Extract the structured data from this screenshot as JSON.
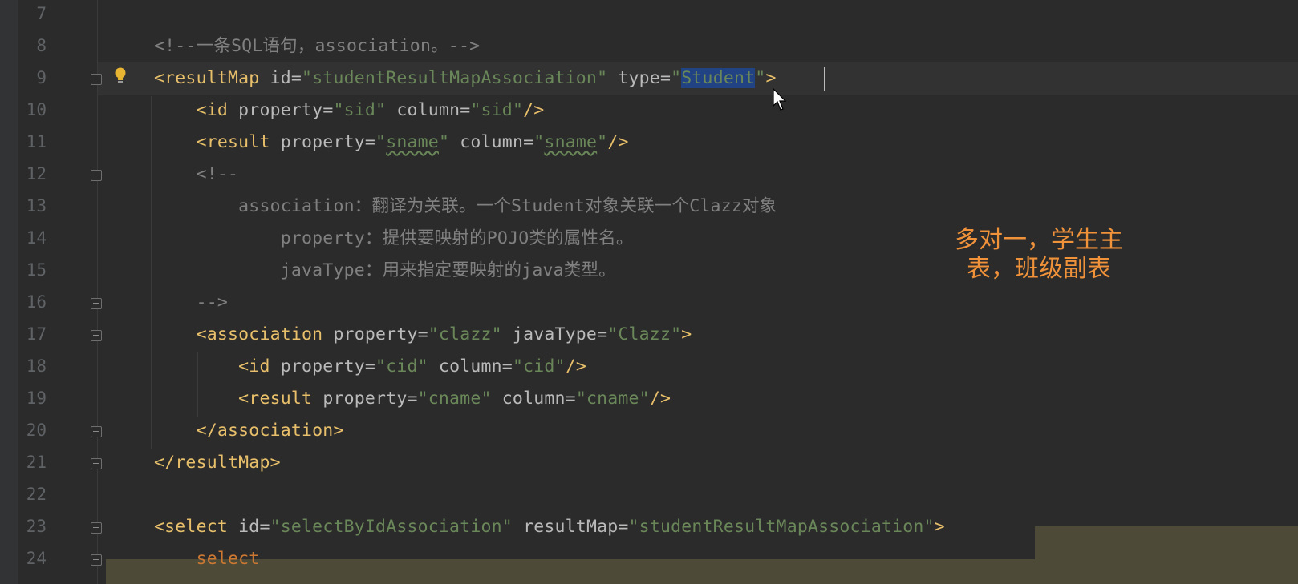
{
  "editor": {
    "lines": [
      {
        "num": "7",
        "tokens": []
      },
      {
        "num": "8",
        "tokens": [
          {
            "t": "cmt",
            "v": "<!--一条SQL语句，association。-->"
          }
        ]
      },
      {
        "num": "9",
        "tokens": [
          {
            "t": "tag",
            "v": "<resultMap "
          },
          {
            "t": "attr",
            "v": "id"
          },
          {
            "t": "eq",
            "v": "="
          },
          {
            "t": "val",
            "v": "\"studentResultMapAssociation\" "
          },
          {
            "t": "attr",
            "v": "type"
          },
          {
            "t": "eq",
            "v": "="
          },
          {
            "t": "val",
            "v": "\""
          },
          {
            "t": "sel",
            "v": "Student"
          },
          {
            "t": "val",
            "v": "\""
          },
          {
            "t": "tag",
            "v": ">"
          }
        ]
      },
      {
        "num": "10",
        "tokens": [
          {
            "t": "tag",
            "v": "    <id "
          },
          {
            "t": "attr",
            "v": "property"
          },
          {
            "t": "eq",
            "v": "="
          },
          {
            "t": "val",
            "v": "\"sid\" "
          },
          {
            "t": "attr",
            "v": "column"
          },
          {
            "t": "eq",
            "v": "="
          },
          {
            "t": "val",
            "v": "\"sid\""
          },
          {
            "t": "tag",
            "v": "/>"
          }
        ]
      },
      {
        "num": "11",
        "tokens": [
          {
            "t": "tag",
            "v": "    <result "
          },
          {
            "t": "attr",
            "v": "property"
          },
          {
            "t": "eq",
            "v": "="
          },
          {
            "t": "val",
            "v": "\""
          },
          {
            "t": "sq",
            "v": "sname"
          },
          {
            "t": "val",
            "v": "\" "
          },
          {
            "t": "attr",
            "v": "column"
          },
          {
            "t": "eq",
            "v": "="
          },
          {
            "t": "val",
            "v": "\""
          },
          {
            "t": "sq",
            "v": "sname"
          },
          {
            "t": "val",
            "v": "\""
          },
          {
            "t": "tag",
            "v": "/>"
          }
        ]
      },
      {
        "num": "12",
        "tokens": [
          {
            "t": "cmt",
            "v": "    <!--"
          }
        ]
      },
      {
        "num": "13",
        "tokens": [
          {
            "t": "cmt",
            "v": "        association：翻译为关联。一个Student对象关联一个Clazz对象"
          }
        ]
      },
      {
        "num": "14",
        "tokens": [
          {
            "t": "cmt",
            "v": "            property：提供要映射的POJO类的属性名。"
          }
        ]
      },
      {
        "num": "15",
        "tokens": [
          {
            "t": "cmt",
            "v": "            javaType：用来指定要映射的java类型。"
          }
        ]
      },
      {
        "num": "16",
        "tokens": [
          {
            "t": "cmt",
            "v": "    -->"
          }
        ]
      },
      {
        "num": "17",
        "tokens": [
          {
            "t": "tag",
            "v": "    <association "
          },
          {
            "t": "attr",
            "v": "property"
          },
          {
            "t": "eq",
            "v": "="
          },
          {
            "t": "val",
            "v": "\"clazz\" "
          },
          {
            "t": "attr",
            "v": "javaType"
          },
          {
            "t": "eq",
            "v": "="
          },
          {
            "t": "val",
            "v": "\"Clazz\""
          },
          {
            "t": "tag",
            "v": ">"
          }
        ]
      },
      {
        "num": "18",
        "tokens": [
          {
            "t": "tag",
            "v": "        <id "
          },
          {
            "t": "attr",
            "v": "property"
          },
          {
            "t": "eq",
            "v": "="
          },
          {
            "t": "val",
            "v": "\"cid\" "
          },
          {
            "t": "attr",
            "v": "column"
          },
          {
            "t": "eq",
            "v": "="
          },
          {
            "t": "val",
            "v": "\"cid\""
          },
          {
            "t": "tag",
            "v": "/>"
          }
        ]
      },
      {
        "num": "19",
        "tokens": [
          {
            "t": "tag",
            "v": "        <result "
          },
          {
            "t": "attr",
            "v": "property"
          },
          {
            "t": "eq",
            "v": "="
          },
          {
            "t": "val",
            "v": "\"cname\" "
          },
          {
            "t": "attr",
            "v": "column"
          },
          {
            "t": "eq",
            "v": "="
          },
          {
            "t": "val",
            "v": "\"cname\""
          },
          {
            "t": "tag",
            "v": "/>"
          }
        ]
      },
      {
        "num": "20",
        "tokens": [
          {
            "t": "tag",
            "v": "    </association>"
          }
        ]
      },
      {
        "num": "21",
        "tokens": [
          {
            "t": "tag",
            "v": "</resultMap>"
          }
        ]
      },
      {
        "num": "22",
        "tokens": []
      },
      {
        "num": "23",
        "tokens": [
          {
            "t": "tag",
            "v": "<select "
          },
          {
            "t": "attr",
            "v": "id"
          },
          {
            "t": "eq",
            "v": "="
          },
          {
            "t": "val",
            "v": "\"selectByIdAssociation\" "
          },
          {
            "t": "attr",
            "v": "resultMap"
          },
          {
            "t": "eq",
            "v": "="
          },
          {
            "t": "val",
            "v": "\"studentResultMapAssociation\""
          },
          {
            "t": "tag",
            "v": ">"
          }
        ]
      },
      {
        "num": "24",
        "tokens": [
          {
            "t": "kw",
            "v": "    select"
          }
        ]
      }
    ]
  },
  "annotation": {
    "line1": "多对一，学生主",
    "line2": "表，班级副表"
  },
  "colors": {
    "background": "#2b2b2b",
    "tag": "#e8bf6a",
    "string": "#6a8759",
    "comment": "#808080",
    "selection": "#214283",
    "annotation": "#f0923a",
    "sql_highlight": "#4d4b38"
  },
  "icons": {
    "intention": "lightbulb-icon",
    "fold": "fold-marker-icon",
    "pointer": "mouse-pointer-icon"
  }
}
